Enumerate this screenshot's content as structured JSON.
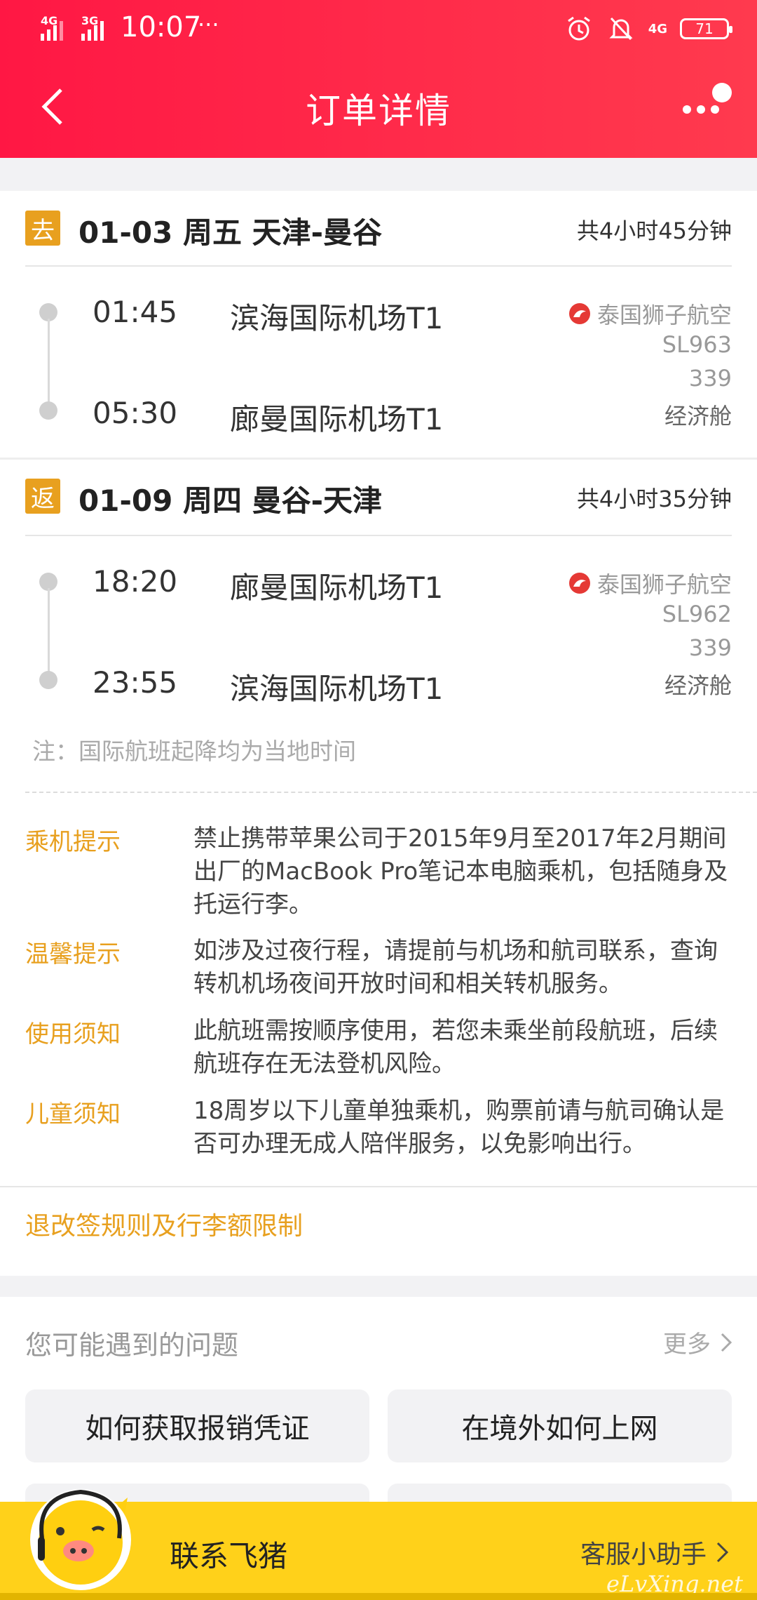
{
  "status_bar": {
    "signal_1": "4G",
    "signal_2": "3G",
    "time": "10:07",
    "overflow": "···",
    "net_type": "4G",
    "battery": "71"
  },
  "header": {
    "title": "订单详情"
  },
  "outbound": {
    "tag": "去",
    "title": "01-03 周五 天津-曼谷",
    "duration": "共4小时45分钟",
    "depart_time": "01:45",
    "depart_airport": "滨海国际机场T1",
    "arrive_time": "05:30",
    "arrive_airport": "廊曼国际机场T1",
    "airline": "泰国狮子航空",
    "flight_no": "SL963",
    "aircraft": "339",
    "cabin": "经济舱"
  },
  "return": {
    "tag": "返",
    "title": "01-09 周四 曼谷-天津",
    "duration": "共4小时35分钟",
    "depart_time": "18:20",
    "depart_airport": "廊曼国际机场T1",
    "arrive_time": "23:55",
    "arrive_airport": "滨海国际机场T1",
    "airline": "泰国狮子航空",
    "flight_no": "SL962",
    "aircraft": "339",
    "cabin": "经济舱"
  },
  "note": "注：国际航班起降均为当地时间",
  "tips": [
    {
      "label": "乘机提示",
      "text": "禁止携带苹果公司于2015年9月至2017年2月期间出厂的MacBook Pro笔记本电脑乘机，包括随身及托运行李。"
    },
    {
      "label": "温馨提示",
      "text": "如涉及过夜行程，请提前与机场和航司联系，查询转机机场夜间开放时间和相关转机服务。"
    },
    {
      "label": "使用须知",
      "text": "此航班需按顺序使用，若您未乘坐前段航班，后续航班存在无法登机风险。"
    },
    {
      "label": "儿童须知",
      "text": "18周岁以下儿童单独乘机，购票前请与航司确认是否可办理无成人陪伴服务，以免影响出行。"
    }
  ],
  "rules_link": "退改签规则及行李额限制",
  "faq": {
    "title": "您可能遇到的问题",
    "more": "更多",
    "items": [
      "如何获取报销凭证",
      "在境外如何上网"
    ]
  },
  "contact": {
    "label": "联系飞猪",
    "assistant": "客服小助手",
    "watermark": "eLvXing.net"
  },
  "colors": {
    "header_red": "#ff1744",
    "accent_orange": "#e8a01f",
    "contact_yellow": "#ffd11a"
  }
}
